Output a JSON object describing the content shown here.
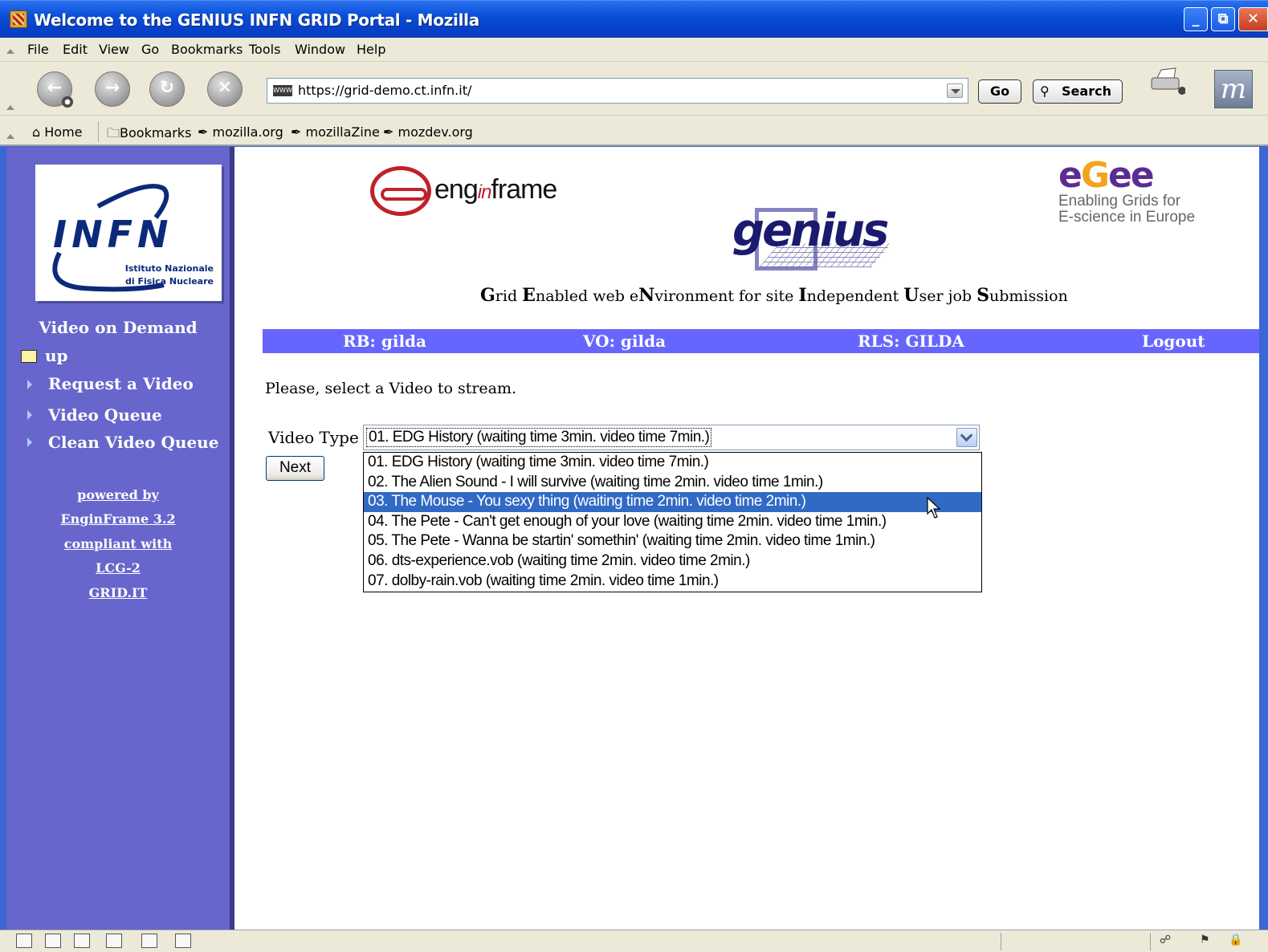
{
  "window": {
    "title": "Welcome to the GENIUS INFN GRID Portal - Mozilla",
    "controls": [
      "_",
      "⧉",
      "✕"
    ]
  },
  "menubar": {
    "items": [
      "File",
      "Edit",
      "View",
      "Go",
      "Bookmarks",
      "Tools",
      "Window",
      "Help"
    ]
  },
  "navbar": {
    "url": "https://grid-demo.ct.infn.it/",
    "go_label": "Go",
    "search_label": "Search",
    "site_icon_text": "WWW",
    "throbber_letter": "m"
  },
  "bookmarks": {
    "items": [
      "Home",
      "Bookmarks",
      "mozilla.org",
      "mozillaZine",
      "mozdev.org"
    ]
  },
  "sidebar": {
    "logo_text": "INFN",
    "logo_sub_1": "Istituto Nazionale",
    "logo_sub_2": "di Fisica Nucleare",
    "section_title": "Video on Demand",
    "up_label": "up",
    "links": [
      "Request a Video",
      "Video Queue",
      "Clean Video Queue"
    ],
    "powered": [
      "powered by",
      "EnginFrame 3.2",
      "compliant with",
      "LCG-2",
      "GRID.IT"
    ]
  },
  "header": {
    "enginframe_logo": "eng in frame",
    "genius_logo": "genius",
    "egee_logo": "egee",
    "egee_tagline_1": "Enabling Grids for",
    "egee_tagline_2": "E-science in Europe",
    "genius_expansion": "Grid Enabled web eNvironment for site Independent User job Submission"
  },
  "infobar": {
    "rb": "RB: gilda",
    "vo": "VO: gilda",
    "rls": "RLS: GILDA",
    "logout": "Logout"
  },
  "form": {
    "prompt": "Please, select a Video to stream.",
    "video_type_label": "Video Type",
    "selected_value": "01. EDG History (waiting time 3min. video time 7min.)",
    "next_label": "Next",
    "highlighted_index": 2,
    "options": [
      "01. EDG History (waiting time 3min. video time 7min.)",
      "02. The Alien Sound - I will survive (waiting time 2min. video time 1min.)",
      "03. The Mouse - You sexy thing (waiting time 2min. video time 2min.)",
      "04. The Pete - Can't get enough of your love (waiting time 2min. video time 1min.)",
      "05. The Pete - Wanna be startin' somethin' (waiting time 2min. video time 1min.)",
      "06. dts-experience.vob (waiting time 2min. video time 2min.)",
      "07. dolby-rain.vob (waiting time 2min. video time 1min.)"
    ]
  },
  "colors": {
    "sidebar": "#6666cc",
    "infobar": "#6666ff",
    "selection": "#316ac5"
  }
}
